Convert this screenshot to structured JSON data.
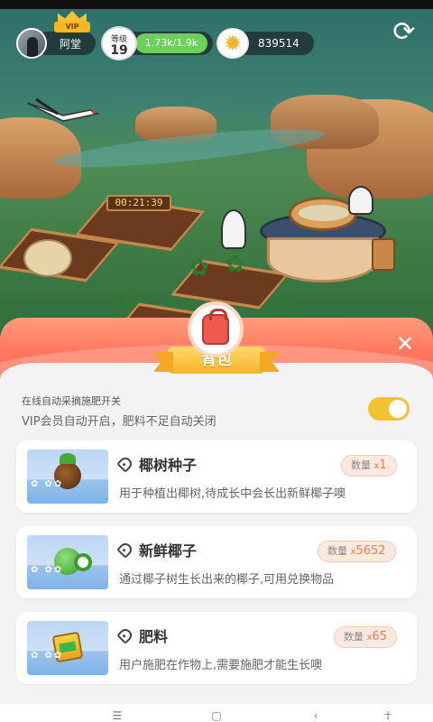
{
  "hud": {
    "username": "阿堂",
    "vip_label": "VIP",
    "level_label": "等级",
    "level": "19",
    "xp": "1.73k/1.9k",
    "coins": "839514",
    "refresh_icon": "refresh-icon"
  },
  "scene": {
    "timer": "00:21:39"
  },
  "panel": {
    "title": "背包",
    "close_icon": "close-icon",
    "switch_title": "在线自动采摘施肥开关",
    "switch_desc": "VIP会员自动开启，肥料不足自动关闭",
    "switch_on": true,
    "qty_label": "数量",
    "qty_x": "x",
    "items": [
      {
        "name": "椰树种子",
        "desc": "用于种植出椰树,待成长中会长出新鲜椰子噢",
        "qty": "1",
        "icon": "coconut-seed-icon"
      },
      {
        "name": "新鲜椰子",
        "desc": "通过椰子树生长出来的椰子,可用兑换物品",
        "qty": "5652",
        "icon": "coconut-icon"
      },
      {
        "name": "肥料",
        "desc": "用户施肥在作物上,需要施肥才能生长噢",
        "qty": "65",
        "icon": "fertilizer-icon"
      }
    ]
  },
  "colors": {
    "accent": "#f3c233",
    "banner": "#ff7560",
    "qty_value": "#ef7b58",
    "xp_bar": "#6cd05a"
  }
}
